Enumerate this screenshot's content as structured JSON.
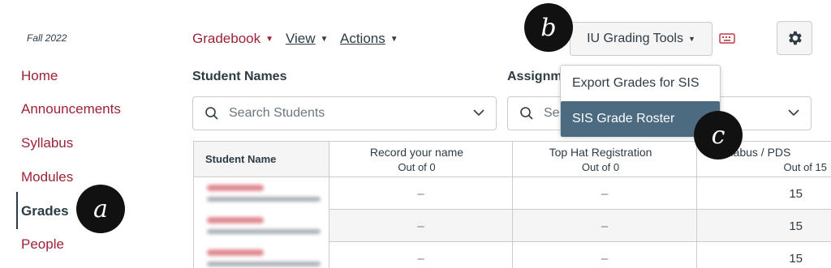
{
  "course_nav": {
    "term": "Fall 2022",
    "items": [
      {
        "label": "Home"
      },
      {
        "label": "Announcements"
      },
      {
        "label": "Syllabus"
      },
      {
        "label": "Modules"
      },
      {
        "label": "Grades"
      },
      {
        "label": "People"
      }
    ],
    "active_item": "Grades"
  },
  "header": {
    "gradebook_label": "Gradebook",
    "view_label": "View",
    "actions_label": "Actions",
    "grading_tools_label": "IU Grading Tools",
    "keyboard_icon": "keyboard-icon",
    "settings_icon": "gear-icon"
  },
  "filters": {
    "student_names_label": "Student Names",
    "student_search_placeholder": "Search Students",
    "assignment_label": "Assignm",
    "assignment_search_placeholder": "Se"
  },
  "dropdown": {
    "items": [
      {
        "label": "Export Grades for SIS"
      },
      {
        "label": "SIS Grade Roster"
      }
    ],
    "highlighted": "SIS Grade Roster"
  },
  "grid": {
    "student_column_header": "Student Name",
    "columns": [
      {
        "title": "Record your name",
        "subtitle": "Out of 0"
      },
      {
        "title": "Top Hat Registration",
        "subtitle": "Out of 0"
      },
      {
        "title": "Syllabus / PDS",
        "subtitle": "Out of 15"
      }
    ],
    "rows": [
      {
        "cells": [
          "–",
          "–",
          "15"
        ]
      },
      {
        "cells": [
          "–",
          "–",
          "15"
        ]
      },
      {
        "cells": [
          "–",
          "–",
          "15"
        ]
      }
    ]
  },
  "annotations": {
    "a": "a",
    "b": "b",
    "c": "c"
  },
  "colors": {
    "brand_red": "#9d2235",
    "text_dark": "#2d3b45",
    "highlight": "#4d6b80"
  }
}
